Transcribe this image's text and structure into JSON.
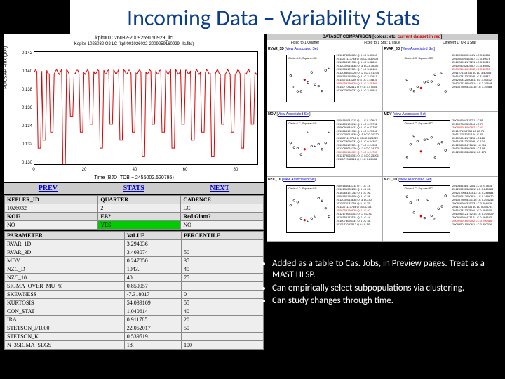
{
  "title": "Incoming Data – Variability Stats",
  "lightcurve": {
    "id_label": "kplr001026032-2009259160929_llc",
    "subtitle": "Kepler 1026032 Q2 LC (kplr001026032-2009259160929_llc.fits)",
    "ylabel": "PDCSAP Flux (10⁴)",
    "xlabel": "Time (BJD_TDB − 2455002.520795)",
    "yticks": [
      "0.142",
      "0.140",
      "0.138",
      "0.136",
      "0.134",
      "0.132",
      "0.130"
    ],
    "xticks": [
      "0",
      "20",
      "40",
      "60",
      "80"
    ]
  },
  "nav": {
    "prev": "PREV",
    "stats": "STATS",
    "next": "NEXT"
  },
  "info_rows": [
    [
      "KEPLER_ID",
      "QUARTER",
      "CADENCE"
    ],
    [
      "1026032",
      "2",
      "LC"
    ],
    [
      "KOI?",
      "EB?",
      "Red Giant?"
    ],
    [
      "NO",
      "YES",
      "NO"
    ]
  ],
  "stats_header": [
    "PARAMETER",
    "VaLUE",
    "PERCENTILE"
  ],
  "stats_rows": [
    [
      "RVAR_1D",
      "3.294036",
      ""
    ],
    [
      "RVAR_3D",
      "3.403074",
      "50"
    ],
    [
      "MDV",
      "0.247050",
      "35"
    ],
    [
      "NZC_D",
      "1043.",
      "40"
    ],
    [
      "NZC_10",
      "40.",
      "75"
    ],
    [
      "SIGMA_OVER_MU_%",
      "0.850057",
      ""
    ],
    [
      "SKEWNESS",
      "-7.318017",
      "0"
    ],
    [
      "KURTOSIS",
      "54.039169",
      "55"
    ],
    [
      "CON_STAT",
      "1.040614",
      "40"
    ],
    [
      "IRA",
      "0.911785",
      "20"
    ],
    [
      "STETSON_J/1000",
      "22.052017",
      "50"
    ],
    [
      "STETSON_K",
      "0.539519",
      ""
    ],
    [
      "N_3SIGMA_SEGS",
      "18.",
      "100"
    ]
  ],
  "compare": {
    "header": "DATASET COMPARISON",
    "note": "current dataset in red",
    "subhdr": [
      "Fixed to 1 Quarter",
      "Fixed to 1 Stat: 1 Value",
      "Different Q OR 1 Stat"
    ],
    "panels": [
      {
        "title": "RVAR_3D",
        "link": "View Associated Set",
        "legend": "Circle=LC, Square=SC",
        "items": [
          "2010174085026 Q 5 LC 3.30043",
          "2011271113734 Q 10 LC 3.32908",
          "2010265121752 Q 6 LC 3.32894",
          "2012032013838 Q 11 LC 3.35387",
          "2010355172524 Q 7 LC 3.38424",
          "2012088054726 Q 12 LC 3.41234",
          "2009350155506 Q 3 LC 3.42911",
          "2011073133259 Q 8 LC 3.45875",
          "2009259160929 Q 2 LC 3.40307",
          "2011177032512 Q 9 LC 3.47514",
          "2010078095331 Q 4 LC 3.48944"
        ]
      },
      {
        "title": "RVAR_3D",
        "link": "View Associated Set",
        "legend": "Circle=LC, Square=SC",
        "items": [
          "2010096490944 1 LC 3.40286",
          "2010005204835 7 LC 3.39676",
          "2010265121752 1 LC 3.40213",
          "2010252525255 7 LC 3.39892",
          "2009259160929 2 LC 3.40307",
          "2011271113734 10 LC 3.40605",
          "2011073133259 8 LC 3.40842",
          "2012004120508 11 LC 3.40532",
          "2012177186943 14 LC 3.39648",
          "2010078095331 16 LC 3.39468"
        ]
      },
      {
        "title": "MDV",
        "link": "View Associated Set",
        "legend": "Circle=LC, Square=SC",
        "items": [
          "2009166044711 Q 1 LC 0.23847",
          "2010203174610 Q 5 LC 0.23792",
          "2009091648421 Q 0 LC 0.23789",
          "2010265121752 Q 6 LC 0.23946",
          "2012032013838 Q 11 LC 0.24220",
          "2011271113734 Q 10 LC 0.24322",
          "2010078095331 Q 4 LC 0.24382",
          "2010355172524 Q 7 LC 0.24392",
          "2012088054726 Q 12 LC 0.24702",
          "2009259160929 Q 2 LC 0.24705",
          "2012179063303 Q 13 LC 0.25201",
          "2011177032512 Q 9 LC 0.25438"
        ]
      },
      {
        "title": "MDV",
        "link": "View Associated Set",
        "legend": "Circle=LC, Square=SC",
        "items": [
          "2009166043257 1 LC 85",
          "2010078095331 4 LC 71",
          "2009259160929 2 LC 43",
          "2011271113734 10 LC 71",
          "2011177032512 9 LC 65",
          "2010265121752 6 LC 118",
          "2011073133259 8 LC 124",
          "2012088054726 12 LC 115",
          "2010174085026 5 LC 108",
          "2012032013838 11 LC 173"
        ]
      },
      {
        "title": "NZC_10",
        "link": "View Associated Set",
        "legend": "Circle=LC, Square=SC",
        "items": [
          "2009166044711 Q 1 LC 13.",
          "2010131082255 Q 5 LC 26.",
          "2010265121752 Q 6 LC 26.",
          "2009350155506 Q 3 LC 28.",
          "2012032013838 Q 11 LC 30.",
          "2011073133259 Q 8 LC 35.",
          "2011271113734 Q 10 LC 38.",
          "2009259160929 Q 2 LC 40.",
          "2012179063303 Q 13 LC 41.",
          "2010355172524 Q 7 LC 44.",
          "2010078095331 Q 4 LC 48.",
          "2011177032512 Q 9 LC 50.",
          "2012088054726 Q 12 LC 54."
        ]
      },
      {
        "title": "NZC_10",
        "link": "View Associated Set",
        "legend": "Circle=LC, Square=SC",
        "items": [
          "2010351684725 4 LC 0.247835",
          "2012032013838 11 LC 0.248584",
          "2012179063303 13 LC 0.248684",
          "2012004120508 14 LC 0.249970",
          "2010078095331 16 LC 0.294248",
          "2009166043257 3 LC 0.294419",
          "2011271113734 10 LC 0.294751",
          "2011073133259 4 LC 0.294970",
          "2010265121752 15 LC 0.294429",
          "2009166044711 1 LC 0.294542",
          "2009259160929 2 LC 0.296486",
          "2009350155506 1 LC 0.350316"
        ]
      }
    ]
  },
  "bullets": [
    "Added as a table to Cas. Jobs, in Preview pages. Treat as a MAST HLSP.",
    "Can empirically select subpopulations via clustering.",
    "Can study changes through time."
  ],
  "chart_data": {
    "type": "line",
    "title": "Kepler 1026032 Q2 LC",
    "xlabel": "Time (BJD_TDB − 2455002.520795)",
    "ylabel": "PDCSAP Flux (×10⁴)",
    "xlim": [
      0,
      90
    ],
    "ylim": [
      0.129,
      0.143
    ],
    "baseline": 0.1405,
    "dips_x": [
      2,
      4,
      7,
      12,
      15,
      19,
      23,
      27,
      31,
      35,
      40,
      44,
      48,
      52,
      56,
      60,
      64,
      68,
      72,
      76,
      80,
      84,
      88
    ],
    "dips_y": [
      0.131,
      0.132,
      0.133,
      0.129,
      0.135,
      0.133,
      0.134,
      0.131,
      0.134,
      0.132,
      0.133,
      0.13,
      0.134,
      0.133,
      0.131,
      0.134,
      0.132,
      0.133,
      0.13,
      0.134,
      0.133,
      0.131,
      0.134
    ]
  }
}
